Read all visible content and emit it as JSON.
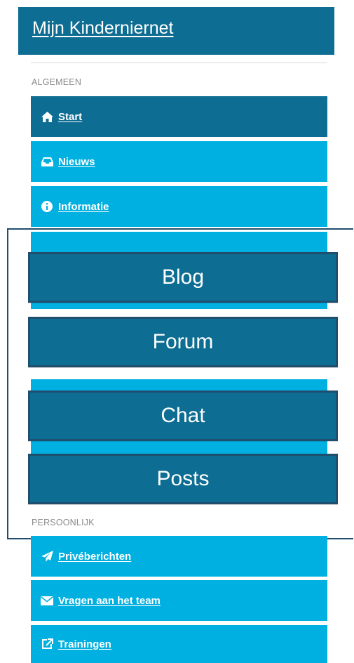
{
  "header": {
    "title": "Mijn Kinderniernet"
  },
  "sections": {
    "algemeen": "ALGEMEEN",
    "persoonlijk": "PERSOONLIJK"
  },
  "nav": {
    "start": {
      "label": "Start",
      "icon": "home-icon"
    },
    "nieuws": {
      "label": "Nieuws",
      "icon": "inbox-icon"
    },
    "informatie": {
      "label": "Informatie",
      "icon": "info-circle-icon"
    },
    "priveberichten": {
      "label": "Privéberichten",
      "icon": "paper-plane-icon"
    },
    "vragen": {
      "label": "Vragen aan het team",
      "icon": "envelope-icon"
    },
    "trainingen": {
      "label": "Trainingen",
      "icon": "external-link-icon"
    }
  },
  "callouts": {
    "blog": "Blog",
    "forum": "Forum",
    "chat": "Chat",
    "posts": "Posts"
  },
  "colors": {
    "header_bg": "#0e6d92",
    "nav_item_bg": "#00b0e0",
    "nav_active_bg": "#0e6d92",
    "callout_border": "#1f4e6e"
  }
}
